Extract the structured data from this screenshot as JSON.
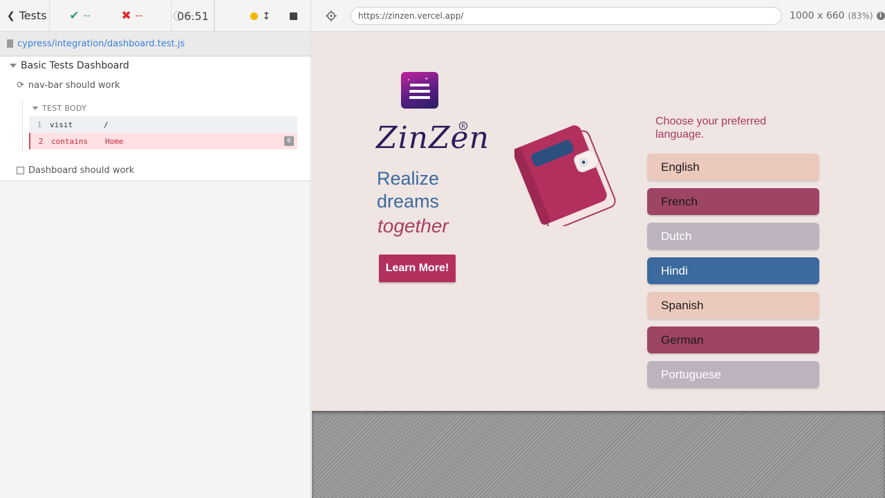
{
  "reporter": {
    "tests_label": "Tests",
    "passed": "--",
    "failed": "--",
    "pending": "--",
    "duration": "06.51",
    "spec_path": "cypress/integration/dashboard.test.js",
    "suite_title": "Basic Tests Dashboard",
    "tests": [
      {
        "title": "nav-bar should work",
        "state": "running"
      },
      {
        "title": "Dashboard should work",
        "state": "queued"
      }
    ],
    "body_title": "TEST BODY",
    "commands": [
      {
        "num": "1",
        "name": "visit",
        "message": "/"
      },
      {
        "num": "2",
        "name": "contains",
        "message": "Home",
        "badge": "0"
      }
    ],
    "colors": {
      "pass": "#2e9f6a",
      "fail": "#e02b2b",
      "running": "#f5b800"
    }
  },
  "aut": {
    "url": "https://zinzen.vercel.app/",
    "viewport": "1000 x 660",
    "scale": "(83%)",
    "app": {
      "logo_text": "ZinZen",
      "tagline_line1": "Realize",
      "tagline_line2": "dreams",
      "tagline_line3": "together",
      "learn_more": "Learn More!",
      "choose_language": "Choose your preferred language.",
      "languages": [
        {
          "label": "English",
          "bg": "#ebc9bc",
          "fg": "#1a1a1a"
        },
        {
          "label": "French",
          "bg": "#9e4464",
          "fg": "#1a1a1a"
        },
        {
          "label": "Dutch",
          "bg": "#bdb3bf",
          "fg": "#ffffff"
        },
        {
          "label": "Hindi",
          "bg": "#3c6a9f",
          "fg": "#ffffff"
        },
        {
          "label": "Spanish",
          "bg": "#ebc9bc",
          "fg": "#1a1a1a"
        },
        {
          "label": "German",
          "bg": "#9e4464",
          "fg": "#1a1a1a"
        },
        {
          "label": "Portuguese",
          "bg": "#bdb3bf",
          "fg": "#ffffff"
        }
      ]
    }
  }
}
